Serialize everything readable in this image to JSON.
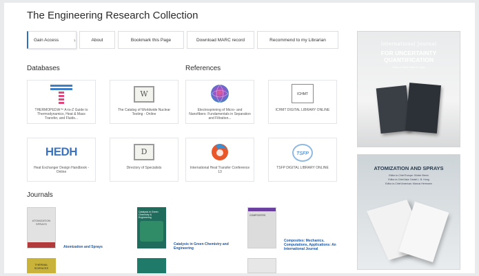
{
  "site": {
    "title": "The Engineering Research Collection"
  },
  "nav": {
    "gain_access": "Gain Access",
    "chevron": "›",
    "about": "About",
    "bookmark": "Bookmark this Page",
    "marc": "Download MARC record",
    "recommend": "Recommend to my Librarian"
  },
  "sections": {
    "databases": "Databases",
    "references": "References",
    "journals": "Journals"
  },
  "databases": [
    {
      "label": "THERMOPEDIA™ A-to-Z Guide to Thermodynamics, Heat & Mass Transfer, and Fluids...",
      "logo_text": ""
    },
    {
      "label": "The Catalog of Worldwide Nuclear Testing - Online",
      "logo_text": "W"
    },
    {
      "label": "Heat Exchanger Design Handbook - Online",
      "logo_text": "HEDH"
    },
    {
      "label": "Directory of Specialists",
      "logo_text": "D"
    }
  ],
  "references": [
    {
      "label": "Electrospinning of Micro- and Nanofibers: Fundamentals in Separation and Filtration...",
      "logo_text": ""
    },
    {
      "label": "ICHMT DIGITAL LIBRARY ONLINE",
      "logo_text": "ICHMT"
    },
    {
      "label": "International Heat Transfer Conference 13",
      "logo_text": ""
    },
    {
      "label": "TSFP DIGITAL LIBRARY ONLINE",
      "logo_text": "TSFP"
    }
  ],
  "journals": [
    {
      "title": "Atomization and Sprays",
      "cover_text": "ATOMIZATION SPRAYS",
      "color": "#d9d9d9"
    },
    {
      "title": "Catalysis in Green Chemistry and Engineering",
      "cover_text": "Catalysis in Green Chemistry & Engineering",
      "color": "#1f6b5c"
    },
    {
      "title": "Composites: Mechanics, Computations, Applications: An International Journal",
      "cover_text": "COMPOSITES",
      "color": "#dcdcdc"
    }
  ],
  "journals_partial": [
    {
      "cover_text": "THERMAL SCIENCES",
      "color": "#c9b33a"
    },
    {
      "cover_text": "",
      "color": "#1f7a6a"
    },
    {
      "cover_text": "",
      "color": "#e7e7e7"
    }
  ],
  "ads": {
    "ad1": {
      "line1": "International Journal",
      "line2a": "FOR UNCERTAINTY",
      "line2b": "QUANTIFICATION",
      "editor": "Editor-in-Chief: Habib N. Najm"
    },
    "ad2": {
      "title": "ATOMIZATION AND SPRAYS",
      "editor1": "Editor-in-Chief Europe: Günter Brenn",
      "editor2": "Editor-in-Chief Asia: Daniel L. B. Hung",
      "editor3": "Editor-in-Chief Americas: Marcus Herrmann"
    }
  },
  "colors": {
    "accent": "#2f6fb8",
    "link": "#1c56a0"
  }
}
